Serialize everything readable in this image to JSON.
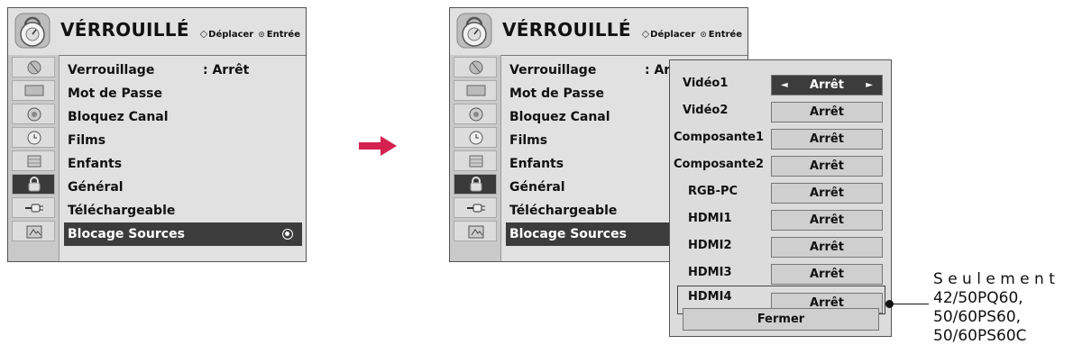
{
  "arrow_color": "#d4214f",
  "menu": {
    "title": "VÉRROUILLÉ",
    "hint_move": "Déplacer",
    "hint_enter": "Entrée",
    "header_icon": "lock-dial-icon",
    "sidebar_icons": [
      "antenna-icon",
      "screen-icon",
      "audio-icon",
      "clock-icon",
      "parental-icon",
      "lock-icon",
      "plug-icon",
      "media-icon"
    ],
    "items": [
      {
        "label": "Verrouillage",
        "value": ": Arrêt"
      },
      {
        "label": "Mot de Passe",
        "value": ""
      },
      {
        "label": "Bloquez Canal",
        "value": ""
      },
      {
        "label": "Films",
        "value": ""
      },
      {
        "label": "Enfants",
        "value": ""
      },
      {
        "label": "Général",
        "value": ""
      },
      {
        "label": "Téléchargeable",
        "value": ""
      },
      {
        "label": "Blocage Sources",
        "value": ""
      }
    ],
    "partial_value": ": Ar"
  },
  "popup": {
    "rows": [
      {
        "label": "Vidéo1",
        "value": "Arrêt"
      },
      {
        "label": "Vidéo2",
        "value": "Arrêt"
      },
      {
        "label": "Composante1",
        "value": "Arrêt"
      },
      {
        "label": "Composante2",
        "value": "Arrêt"
      },
      {
        "label": "RGB-PC",
        "value": "Arrêt"
      },
      {
        "label": "HDMI1",
        "value": "Arrêt"
      },
      {
        "label": "HDMI2",
        "value": "Arrêt"
      },
      {
        "label": "HDMI3",
        "value": "Arrêt"
      },
      {
        "label": "HDMI4",
        "value": "Arrêt"
      }
    ],
    "close_label": "Fermer"
  },
  "note": {
    "line1": "Seulement",
    "line2": "42/50PQ60,",
    "line3": "50/60PS60,",
    "line4": "50/60PS60C"
  }
}
